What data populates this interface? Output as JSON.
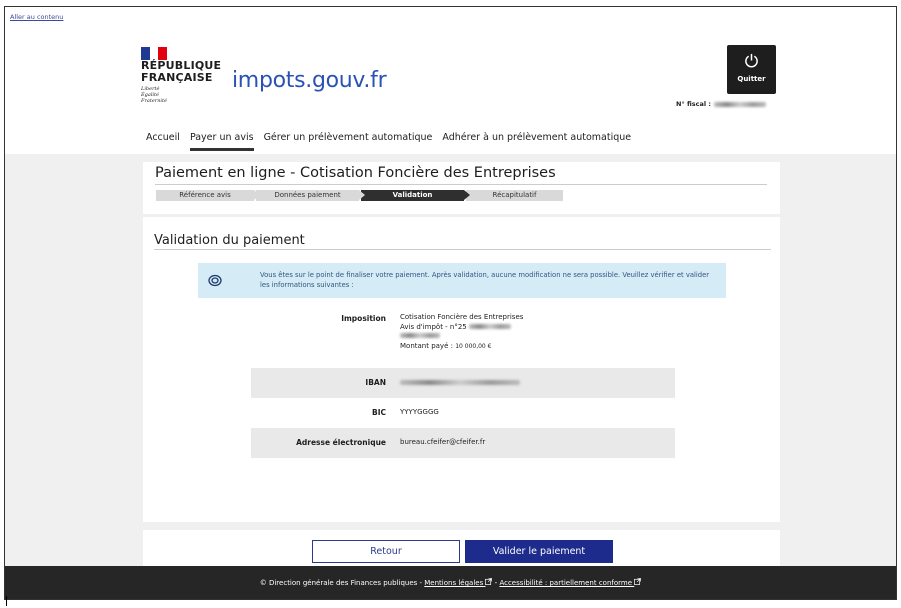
{
  "skip_link": "Aller au contenu",
  "header": {
    "rf_title_line1": "RÉPUBLIQUE",
    "rf_title_line2": "FRANÇAISE",
    "rf_motto_1": "Liberté",
    "rf_motto_2": "Égalité",
    "rf_motto_3": "Fraternité",
    "brand": "impots.gouv.fr",
    "quit_label": "Quitter",
    "fiscal_label": "N° fiscal :"
  },
  "nav": {
    "items": [
      {
        "label": "Accueil"
      },
      {
        "label": "Payer un avis"
      },
      {
        "label": "Gérer un prélèvement automatique"
      },
      {
        "label": "Adhérer à un prélèvement automatique"
      }
    ]
  },
  "payment": {
    "title": "Paiement en ligne - Cotisation Foncière des Entreprises",
    "steps": [
      {
        "label": "Référence avis"
      },
      {
        "label": "Données paiement"
      },
      {
        "label": "Validation"
      },
      {
        "label": "Récapitulatif"
      }
    ]
  },
  "validation": {
    "title": "Validation du paiement",
    "info_text": "Vous êtes sur le point de finaliser votre paiement. Après validation, aucune modification ne sera possible. Veuillez vérifier et valider les informations suivantes :",
    "imposition_label": "Imposition",
    "imposition_line1": "Cotisation Foncière des Entreprises",
    "imposition_line2": "Avis d'impôt  - n°25",
    "montant_label": "Montant payé : ",
    "montant_value": "10 000,00 €",
    "iban_label": "IBAN",
    "bic_label": "BIC",
    "bic_value": "YYYYGGGG",
    "email_label": "Adresse électronique",
    "email_value": "bureau.cfeifer@cfeifer.fr"
  },
  "actions": {
    "back_label": "Retour",
    "validate_label": "Valider le paiement"
  },
  "footer": {
    "text": "© Direction générale des Finances publiques - ",
    "legal": "Mentions légales",
    "sep": " - ",
    "accessibility": "Accessibilité : partiellement conforme"
  },
  "colors": {
    "brand_blue": "#2a52b5",
    "button_blue": "#1d2b8c",
    "info_bg": "#d5ebf5"
  }
}
